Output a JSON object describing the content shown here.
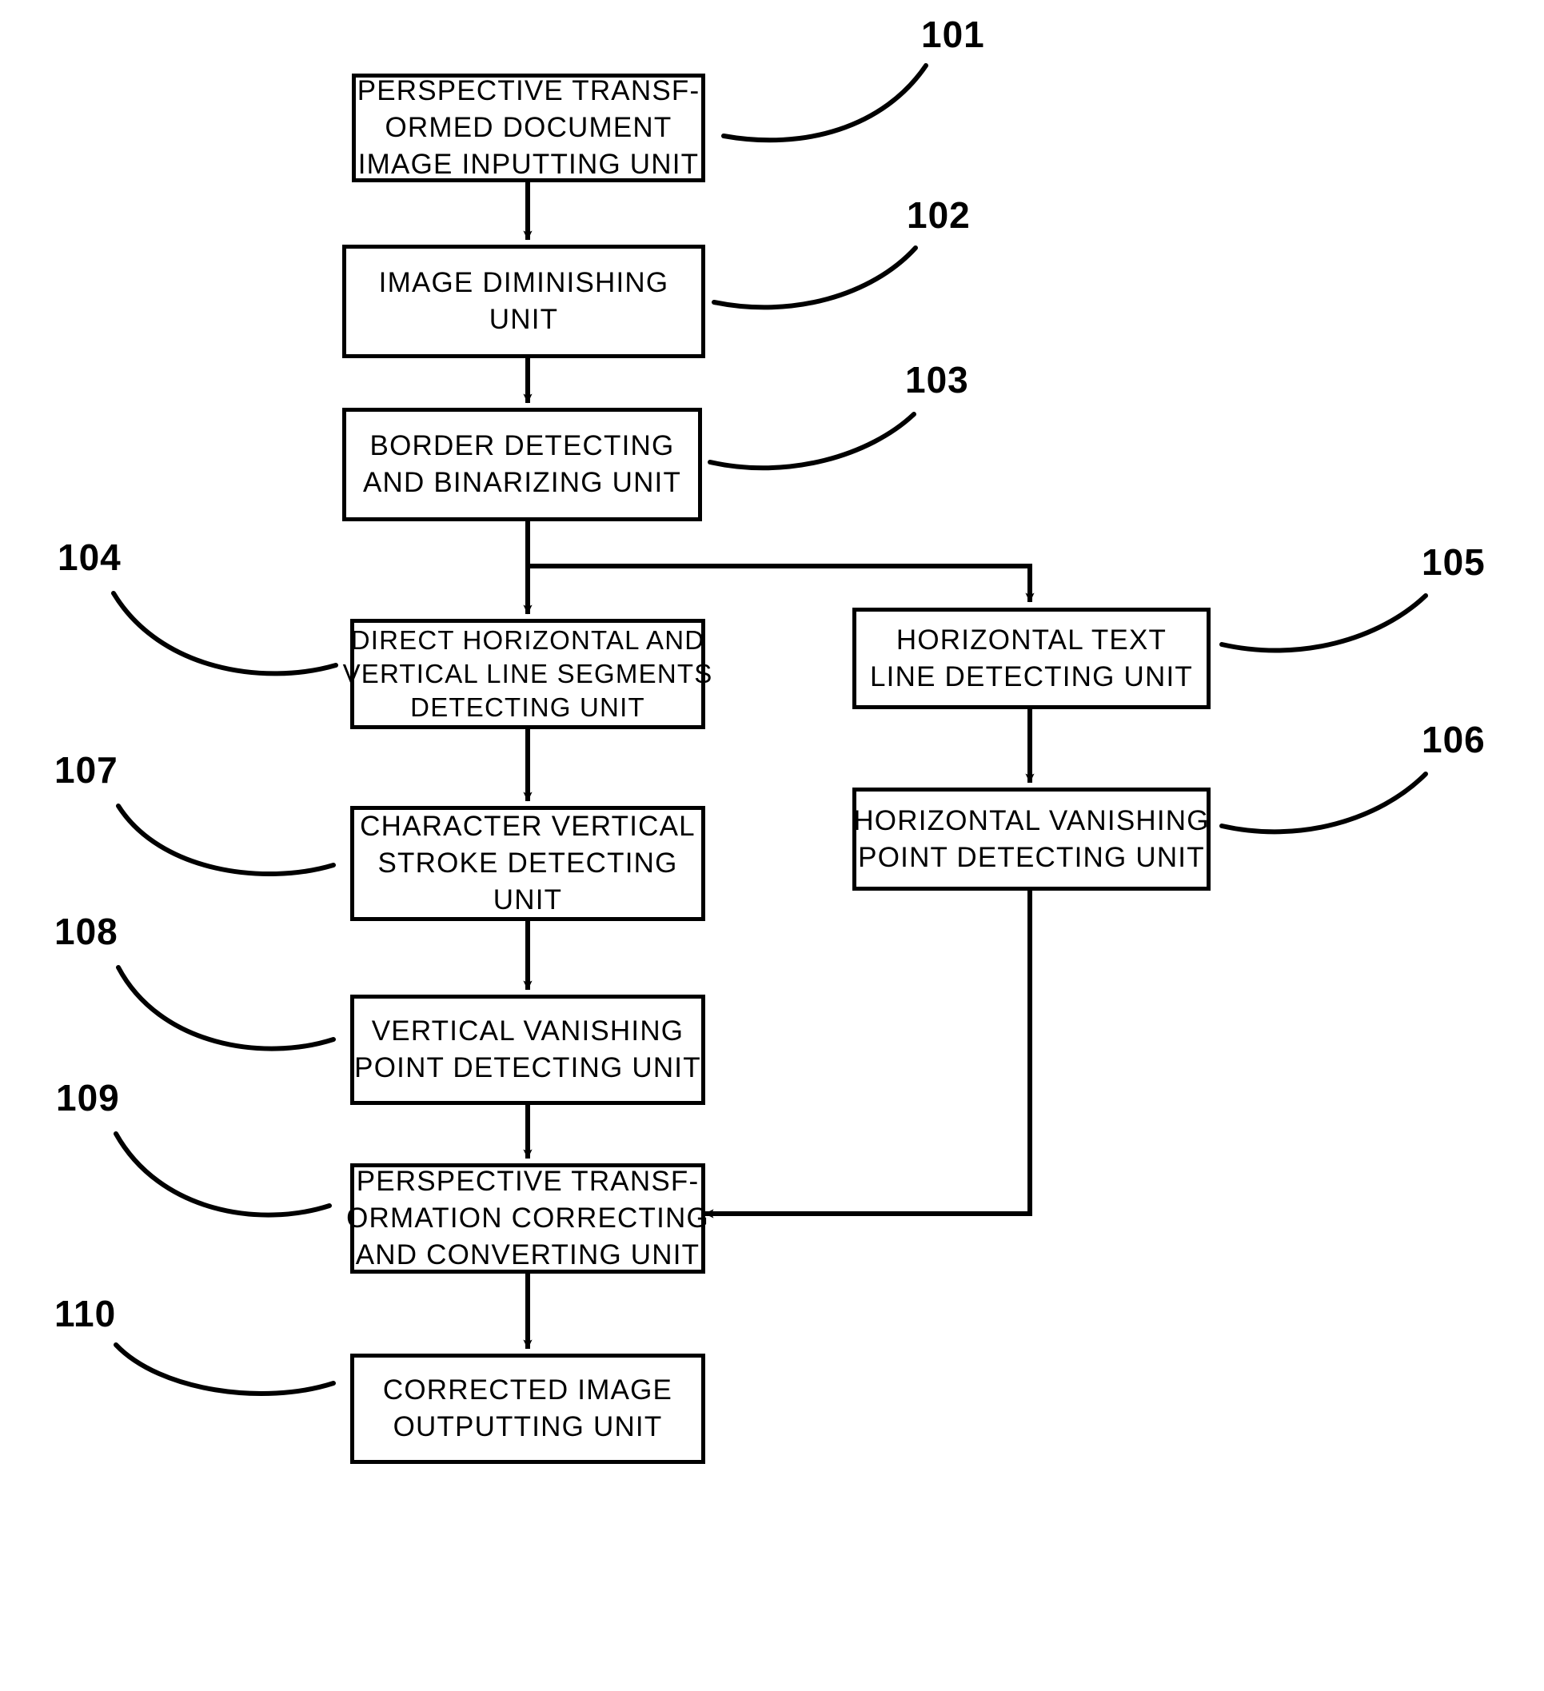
{
  "figure": {
    "title": "Perspective transformation correction apparatus block diagram",
    "stroke_color": "#000000",
    "background_color": "#ffffff"
  },
  "nodes": [
    {
      "ref": "101",
      "name": "perspective-transformed-document-image-inputting-unit",
      "lines": [
        "PERSPECTIVE TRANSF-",
        "ORMED DOCUMENT",
        "IMAGE INPUTTING UNIT"
      ],
      "ref_label": "101"
    },
    {
      "ref": "102",
      "name": "image-diminishing-unit",
      "lines": [
        "IMAGE DIMINISHING",
        "UNIT"
      ],
      "ref_label": "102"
    },
    {
      "ref": "103",
      "name": "border-detecting-and-binarizing-unit",
      "lines": [
        "BORDER DETECTING",
        "AND BINARIZING UNIT"
      ],
      "ref_label": "103"
    },
    {
      "ref": "104",
      "name": "direct-horizontal-and-vertical-line-segments-detecting-unit",
      "lines": [
        "DIRECT HORIZONTAL AND",
        "VERTICAL LINE SEGMENTS",
        "DETECTING UNIT"
      ],
      "ref_label": "104"
    },
    {
      "ref": "105",
      "name": "horizontal-text-line-detecting-unit",
      "lines": [
        "HORIZONTAL TEXT",
        "LINE DETECTING UNIT"
      ],
      "ref_label": "105"
    },
    {
      "ref": "106",
      "name": "horizontal-vanishing-point-detecting-unit",
      "lines": [
        "HORIZONTAL VANISHING",
        "POINT DETECTING UNIT"
      ],
      "ref_label": "106"
    },
    {
      "ref": "107",
      "name": "character-vertical-stroke-detecting-unit",
      "lines": [
        "CHARACTER VERTICAL",
        "STROKE DETECTING",
        "UNIT"
      ],
      "ref_label": "107"
    },
    {
      "ref": "108",
      "name": "vertical-vanishing-point-detecting-unit",
      "lines": [
        "VERTICAL VANISHING",
        "POINT DETECTING UNIT"
      ],
      "ref_label": "108"
    },
    {
      "ref": "109",
      "name": "perspective-transformation-correcting-and-converting-unit",
      "lines": [
        "PERSPECTIVE TRANSF-",
        "ORMATION CORRECTING",
        "AND CONVERTING UNIT"
      ],
      "ref_label": "109"
    },
    {
      "ref": "110",
      "name": "corrected-image-outputting-unit",
      "lines": [
        "CORRECTED IMAGE",
        "OUTPUTTING UNIT"
      ],
      "ref_label": "110"
    }
  ],
  "connections": [
    {
      "name": "arrow-101-to-102",
      "from": "101",
      "to": "102"
    },
    {
      "name": "arrow-102-to-103",
      "from": "102",
      "to": "103"
    },
    {
      "name": "arrow-103-to-104",
      "from": "103",
      "to": "104"
    },
    {
      "name": "arrow-103-to-105",
      "from": "103",
      "to": "105"
    },
    {
      "name": "arrow-104-to-107",
      "from": "104",
      "to": "107"
    },
    {
      "name": "arrow-105-to-106",
      "from": "105",
      "to": "106"
    },
    {
      "name": "arrow-107-to-108",
      "from": "107",
      "to": "108"
    },
    {
      "name": "arrow-108-to-109",
      "from": "108",
      "to": "109"
    },
    {
      "name": "arrow-106-to-109",
      "from": "106",
      "to": "109"
    },
    {
      "name": "arrow-109-to-110",
      "from": "109",
      "to": "110"
    }
  ]
}
